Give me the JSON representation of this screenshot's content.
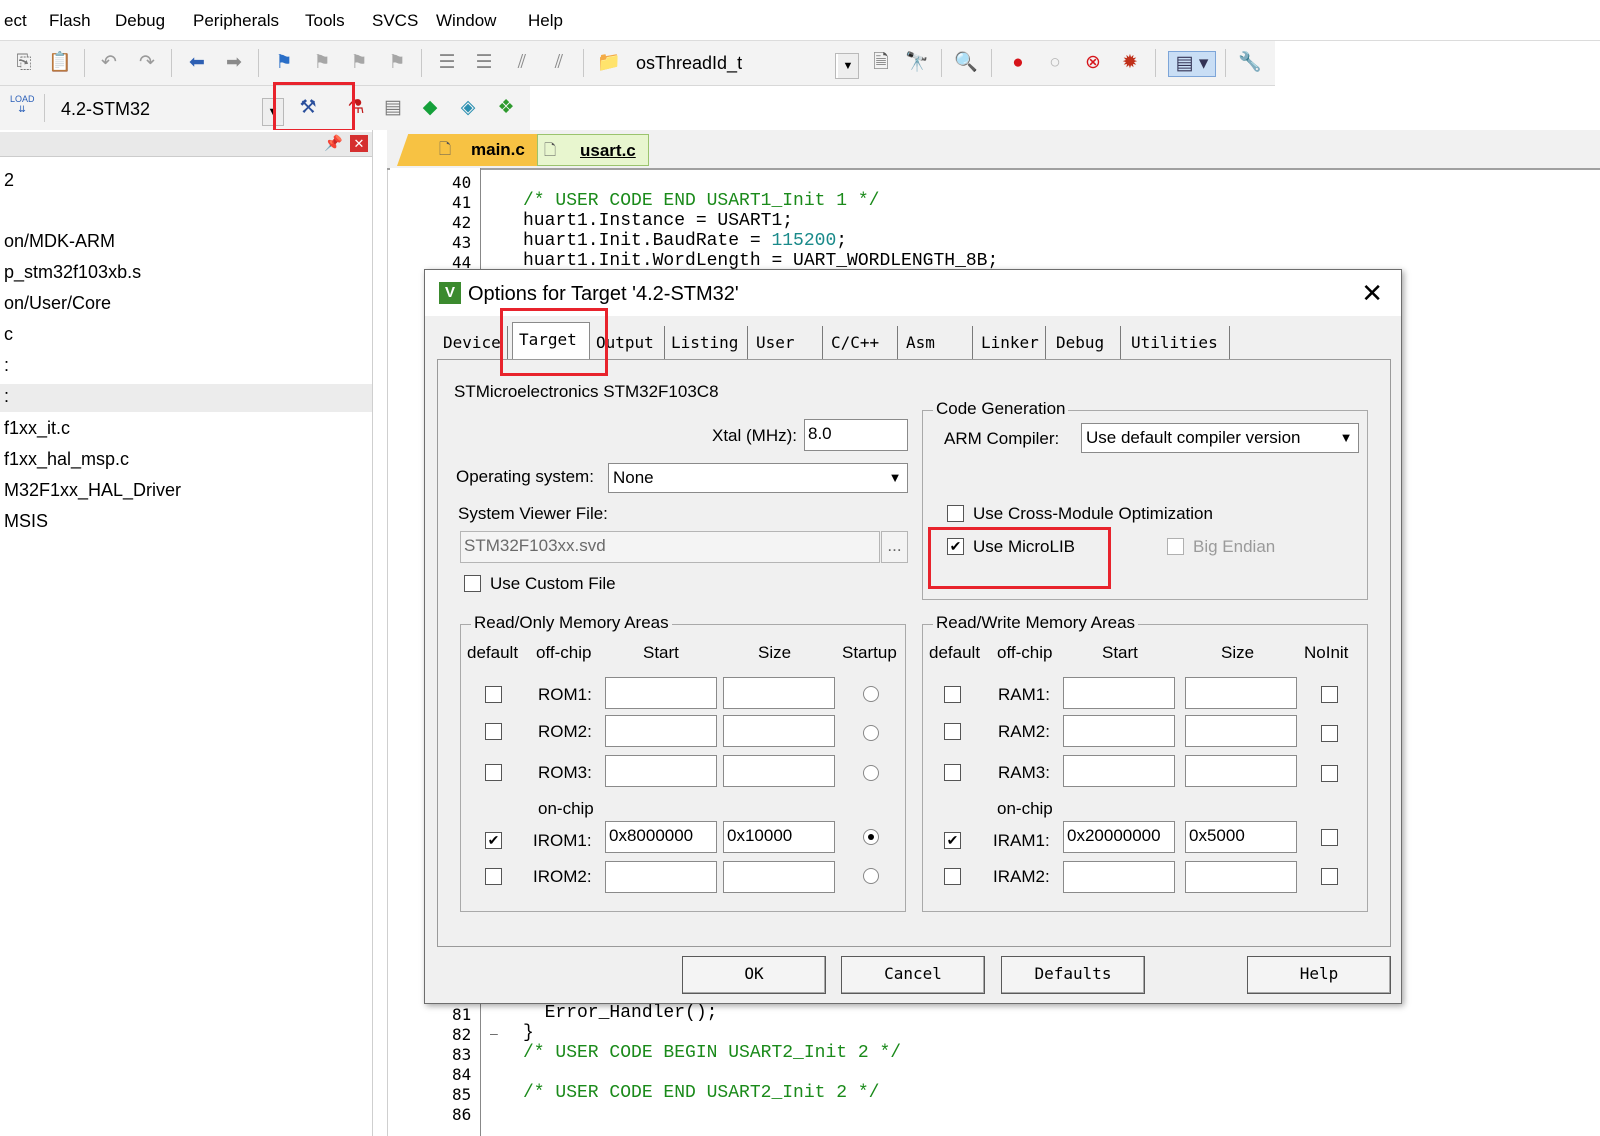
{
  "menu": [
    "ect",
    "Flash",
    "Debug",
    "Peripherals",
    "Tools",
    "SVCS",
    "Window",
    "Help"
  ],
  "toolbar": {
    "thread_combo": "osThreadId_t",
    "target_combo": "4.2-STM32",
    "load_label": "LOAD"
  },
  "project_tree": [
    "2",
    "on/MDK-ARM",
    "p_stm32f103xb.s",
    "on/User/Core",
    "c",
    ":",
    ":",
    "f1xx_it.c",
    "f1xx_hal_msp.c",
    "M32F1xx_HAL_Driver",
    "MSIS"
  ],
  "editor": {
    "tabs": [
      "main.c",
      "usart.c"
    ],
    "active_tab": "usart.c",
    "top_lines": [
      {
        "n": "40",
        "code": ""
      },
      {
        "n": "41",
        "code": "/* USER CODE END USART1_Init 1 */"
      },
      {
        "n": "42",
        "code": "huart1.Instance = USART1;"
      },
      {
        "n": "43",
        "code": "huart1.Init.BaudRate = ",
        "num": "115200",
        "tail": ";"
      },
      {
        "n": "44",
        "code": "huart1.Init.WordLength = UART_WORDLENGTH_8B;"
      }
    ],
    "bottom_lines": [
      {
        "n": "81",
        "code": "  Error_Handler();"
      },
      {
        "n": "82",
        "code": "}"
      },
      {
        "n": "83",
        "code": "/* USER CODE BEGIN USART2_Init 2 */"
      },
      {
        "n": "84",
        "code": ""
      },
      {
        "n": "85",
        "code": "/* USER CODE END USART2_Init 2 */"
      },
      {
        "n": "86",
        "code": ""
      }
    ]
  },
  "dialog": {
    "title": "Options for Target '4.2-STM32'",
    "tabs": [
      "Device",
      "Target",
      "Output",
      "Listing",
      "User",
      "C/C++",
      "Asm",
      "Linker",
      "Debug",
      "Utilities"
    ],
    "active_tab": "Target",
    "device_name": "STMicroelectronics STM32F103C8",
    "xtal_label": "Xtal (MHz):",
    "xtal_value": "8.0",
    "os_label": "Operating system:",
    "os_value": "None",
    "svf_label": "System Viewer File:",
    "svf_value": "STM32F103xx.svd",
    "browse_label": "...",
    "use_custom_file": "Use Custom File",
    "code_gen": {
      "title": "Code Generation",
      "compiler_label": "ARM Compiler:",
      "compiler_value": "Use default compiler version",
      "cross_module": "Use Cross-Module Optimization",
      "microlib": "Use MicroLIB",
      "microlib_checked": true,
      "big_endian": "Big Endian"
    },
    "rom": {
      "title": "Read/Only Memory Areas",
      "headers": [
        "default",
        "off-chip",
        "Start",
        "Size",
        "Startup"
      ],
      "onchip_label": "on-chip",
      "rows": [
        {
          "name": "ROM1:",
          "start": "",
          "size": "",
          "default": false,
          "startup": false
        },
        {
          "name": "ROM2:",
          "start": "",
          "size": "",
          "default": false,
          "startup": false
        },
        {
          "name": "ROM3:",
          "start": "",
          "size": "",
          "default": false,
          "startup": false
        },
        {
          "name": "IROM1:",
          "start": "0x8000000",
          "size": "0x10000",
          "default": true,
          "startup": true
        },
        {
          "name": "IROM2:",
          "start": "",
          "size": "",
          "default": false,
          "startup": false
        }
      ]
    },
    "ram": {
      "title": "Read/Write Memory Areas",
      "headers": [
        "default",
        "off-chip",
        "Start",
        "Size",
        "NoInit"
      ],
      "onchip_label": "on-chip",
      "rows": [
        {
          "name": "RAM1:",
          "start": "",
          "size": "",
          "default": false,
          "noinit": false
        },
        {
          "name": "RAM2:",
          "start": "",
          "size": "",
          "default": false,
          "noinit": false
        },
        {
          "name": "RAM3:",
          "start": "",
          "size": "",
          "default": false,
          "noinit": false
        },
        {
          "name": "IRAM1:",
          "start": "0x20000000",
          "size": "0x5000",
          "default": true,
          "noinit": false
        },
        {
          "name": "IRAM2:",
          "start": "",
          "size": "",
          "default": false,
          "noinit": false
        }
      ]
    },
    "buttons": {
      "ok": "OK",
      "cancel": "Cancel",
      "defaults": "Defaults",
      "help": "Help"
    }
  },
  "colors": {
    "highlight": "#e8232c",
    "comment": "#1a8a1a",
    "number": "#1a8a8a"
  }
}
